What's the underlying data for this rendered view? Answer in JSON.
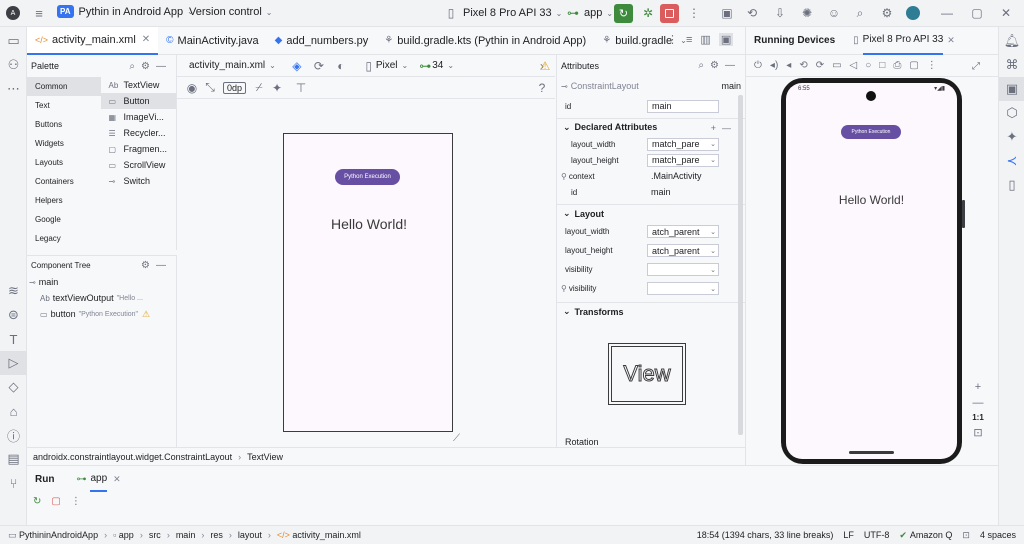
{
  "topbar": {
    "project_badge": "PA",
    "project_name": "Pythin in Android App",
    "vcs": "Version control",
    "device_name": "Pixel 8 Pro API 33",
    "run_config": "app"
  },
  "tabs": [
    {
      "label": "activity_main.xml"
    },
    {
      "label": "MainActivity.java"
    },
    {
      "label": "add_numbers.py"
    },
    {
      "label": "build.gradle.kts (Pythin in Android App)"
    },
    {
      "label": "build.gradle"
    }
  ],
  "palette": {
    "title": "Palette",
    "categories": [
      "Common",
      "Text",
      "Buttons",
      "Widgets",
      "Layouts",
      "Containers",
      "Helpers",
      "Google",
      "Legacy"
    ],
    "widgets": [
      {
        "icon": "Ab",
        "label": "TextView"
      },
      {
        "icon": "▭",
        "label": "Button"
      },
      {
        "icon": "▦",
        "label": "ImageVi..."
      },
      {
        "icon": "☰",
        "label": "Recycler..."
      },
      {
        "icon": "▢",
        "label": "Fragmen..."
      },
      {
        "icon": "▭",
        "label": "ScrollView"
      },
      {
        "icon": "⊸",
        "label": "Switch"
      }
    ]
  },
  "component_tree": {
    "title": "Component Tree",
    "root": "main",
    "items": [
      {
        "icon": "Ab",
        "label": "textViewOutput",
        "hint": "\"Hello ..."
      },
      {
        "icon": "▭",
        "label": "button",
        "hint": "\"Python Execution\""
      }
    ]
  },
  "design": {
    "file": "activity_main.xml",
    "device": "Pixel",
    "api": "34",
    "margin": "0dp"
  },
  "preview": {
    "button_label": "Python Execution",
    "hello_text": "Hello World!"
  },
  "attributes": {
    "title": "Attributes",
    "class_name": "ConstraintLayout",
    "id_label": "main",
    "id_row": {
      "name": "id",
      "value": "main"
    },
    "declared_title": "Declared Attributes",
    "declared": [
      {
        "name": "layout_width",
        "value": "match_pare"
      },
      {
        "name": "layout_height",
        "value": "match_pare"
      },
      {
        "name": "context",
        "value": ".MainActivity"
      },
      {
        "name": "id",
        "value": "main"
      }
    ],
    "layout_title": "Layout",
    "layout": [
      {
        "name": "layout_width",
        "value": "atch_parent"
      },
      {
        "name": "layout_height",
        "value": "atch_parent"
      },
      {
        "name": "visibility",
        "value": ""
      },
      {
        "name": "visibility",
        "value": ""
      }
    ],
    "transforms_title": "Transforms",
    "view_label": "View",
    "rotation_label": "Rotation"
  },
  "running": {
    "title": "Running Devices",
    "device_tab": "Pixel 8 Pro API 33",
    "phone_time": "6:55",
    "button_label": "Python Execution",
    "hello_text": "Hello World!",
    "zoom_ratio": "1:1"
  },
  "breadcrumb": {
    "path": "androidx.constraintlayout.widget.ConstraintLayout",
    "leaf": "TextView"
  },
  "run_panel": {
    "title": "Run",
    "config_tab": "app"
  },
  "statusbar": {
    "crumbs": [
      "PythininAndroidApp",
      "app",
      "src",
      "main",
      "res",
      "layout",
      "activity_main.xml"
    ],
    "position": "18:54 (1394 chars, 33 line breaks)",
    "line_sep": "LF",
    "encoding": "UTF-8",
    "plugin": "Amazon Q",
    "indent": "4 spaces"
  }
}
